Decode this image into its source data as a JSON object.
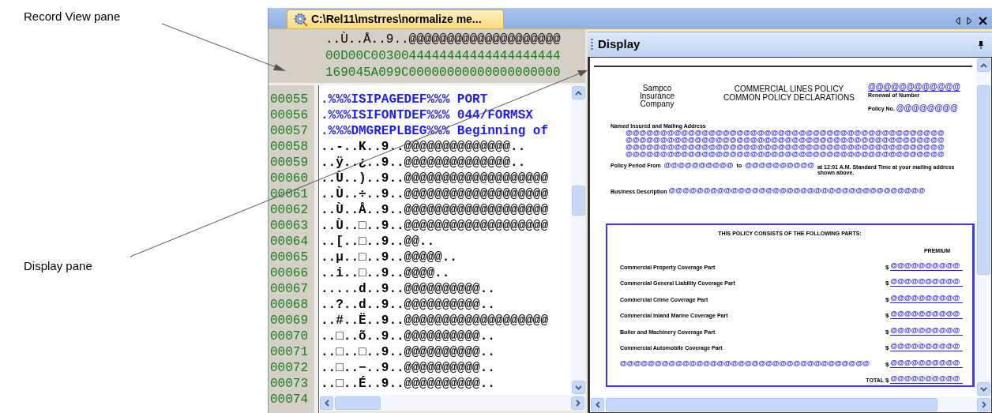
{
  "annotations": [
    {
      "text": "Record View pane"
    },
    {
      "text": "Display pane"
    }
  ],
  "tab": {
    "title": "C:\\Rel11\\mstrres\\normalize me...",
    "selected": true
  },
  "record_view": {
    "header_lines": [
      {
        "kind": "text",
        "text": "..Ù..Å..9..@@@@@@@@@@@@@@@@@@@@"
      },
      {
        "kind": "hex",
        "text": "00D00C0030044444444444444444444"
      },
      {
        "kind": "hex",
        "text": "169045A099C00000000000000000000"
      }
    ],
    "rows": [
      {
        "number": "00055",
        "kind": "directive",
        "text": ".%%%ISIPAGEDEF%%% PORT"
      },
      {
        "number": "00056",
        "kind": "directive",
        "text": ".%%%ISIFONTDEF%%% 044/FORMSX"
      },
      {
        "number": "00057",
        "kind": "directive",
        "text": ".%%%DMGREPLBEG%%% Beginning of"
      },
      {
        "number": "00058",
        "kind": "data",
        "text": "..-..K..9..@@@@@@@@@@@@@@.."
      },
      {
        "number": "00059",
        "kind": "data",
        "text": "..ÿ..¿..9..@@@@@@@@@@@@@@.."
      },
      {
        "number": "00060",
        "kind": "data",
        "text": "..Ù..)..9..@@@@@@@@@@@@@@@@@@@"
      },
      {
        "number": "00061",
        "kind": "data",
        "text": "..Ù..÷..9..@@@@@@@@@@@@@@@@@@@"
      },
      {
        "number": "00062",
        "kind": "data",
        "text": "..Ù..Å..9..@@@@@@@@@@@@@@@@@@@"
      },
      {
        "number": "00063",
        "kind": "data",
        "text": "..Ù..□..9..@@@@@@@@@@@@@@@@@@@"
      },
      {
        "number": "00064",
        "kind": "data",
        "text": "..[..□..9..@@.."
      },
      {
        "number": "00065",
        "kind": "data",
        "text": "..µ..□..9..@@@@@.."
      },
      {
        "number": "00066",
        "kind": "data",
        "text": "..i..□..9..@@@@.."
      },
      {
        "number": "00067",
        "kind": "data",
        "text": ".....d..9..@@@@@@@@@@.."
      },
      {
        "number": "00068",
        "kind": "data",
        "text": "..?..d..9..@@@@@@@@@@.."
      },
      {
        "number": "00069",
        "kind": "data",
        "text": "..#..Ë..9..@@@@@@@@@@@@@@@@@@@"
      },
      {
        "number": "00070",
        "kind": "data",
        "text": "..□..õ..9..@@@@@@@@@@.."
      },
      {
        "number": "00071",
        "kind": "data",
        "text": "..□..□..9..@@@@@@@@@@.."
      },
      {
        "number": "00072",
        "kind": "data",
        "text": "..□..−..9..@@@@@@@@@@.."
      },
      {
        "number": "00073",
        "kind": "data",
        "text": "..□..É..9..@@@@@@@@@@.."
      },
      {
        "number": "00074"
      }
    ]
  },
  "display": {
    "title": "Display",
    "document": {
      "company": [
        "Sampco",
        "Insurance",
        "Company"
      ],
      "title_lines": [
        "COMMERCIAL LINES POLICY",
        "COMMON POLICY DECLARATIONS"
      ],
      "renewal_value": "@@@@@@@@@@@@",
      "renewal_label": "Renewal of Number",
      "policy_no_label": "Policy No.",
      "policy_no_value": "@@@@@@@@",
      "named_insured_label": "Named Insured and Mailing Address",
      "named_insured_lines": [
        "@@@@@@@@@@@@@@@@@@@@@@@@@@@@@@@@@@@@@@@@@@@@@@",
        "@@@@@@@@@@@@@@@@@@@@@@@@@@@@@@@@@@@@@@@@@@@@@@",
        "@@@@@@@@@@@@@@@@@@@@@@@@@@@@@@@@@@@@@@@@@@@@@@",
        "@@@@@@@@@@@@@@@@@@@@@@@@@@@@@@@@@@@@@@@@@@@@@@"
      ],
      "period_label": "Policy Period From",
      "period_from": "@@@@@@@@@@",
      "period_to_label": "to",
      "period_to": "@@@@@@@@@@",
      "period_note": "at 12:01 A.M. Standard Time at your mailing address shown above.",
      "business_label": "Business Description",
      "business_value": "@@@@@@@@@@@@@@@@@@@@@@@@@@@@@@@@@@@@@",
      "parts_title": "THIS POLICY CONSISTS OF THE FOLLOWING PARTS:",
      "premium_heading": "PREMIUM",
      "parts": [
        {
          "kind": "label",
          "label": "Commercial Property Coverage Part",
          "currency": "$",
          "value": "@@@@@@@@@@"
        },
        {
          "kind": "label",
          "label": "Commercial General Liability Coverage Part",
          "currency": "$",
          "value": "@@@@@@@@@@"
        },
        {
          "kind": "label",
          "label": "Commercial Crime Coverage Part",
          "currency": "$",
          "value": "@@@@@@@@@@"
        },
        {
          "kind": "label",
          "label": "Commercial Inland Marine Coverage Part",
          "currency": "$",
          "value": "@@@@@@@@@@"
        },
        {
          "kind": "label",
          "label": "Boiler and Machinery Coverage Part",
          "currency": "$",
          "value": "@@@@@@@@@@"
        },
        {
          "kind": "label",
          "label": "Commercial Automobile Coverage Part",
          "currency": "$",
          "value": "@@@@@@@@@@"
        },
        {
          "kind": "field",
          "label": "@@@@@@@@@@@@@@@@@@@@@@@@@@@@@@@@@@@@",
          "currency": "$",
          "value": "@@@@@@@@@@"
        }
      ],
      "total_label": "TOTAL",
      "total_currency": "$",
      "total_value": "@@@@@@@@@@"
    }
  }
}
